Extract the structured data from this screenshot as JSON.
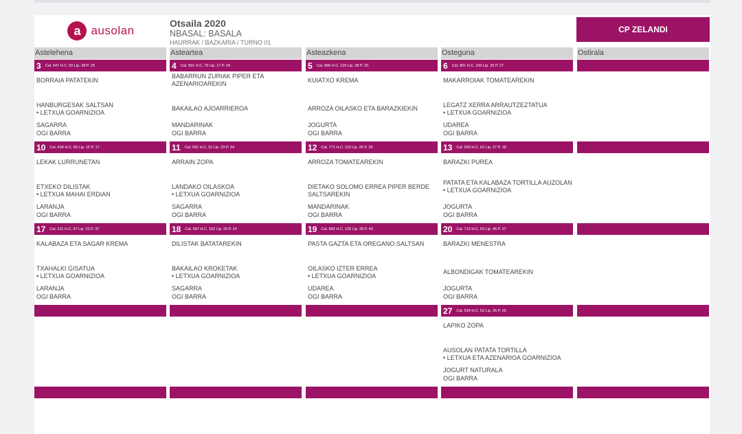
{
  "header": {
    "logo_letter": "a",
    "logo_text": "ausolan",
    "month": "Otsaila 2020",
    "menu_type": "NBASAL: BASALA",
    "subtitle": "HAURRAK / BAZKARIA / TURNO 01",
    "school": "CP ZELANDI"
  },
  "days": [
    "Astelehena",
    "Asteartea",
    "Asteazkena",
    "Osteguna",
    "Ostirala"
  ],
  "weeks": [
    [
      {
        "num": "3",
        "info": "Cal. 647 H.C. 50 Lip. 38 P. 25",
        "first": "BORRAIA PATATEKIN",
        "second": "HANBURGESAK SALTSAN",
        "second_note": "LETXUA GOARNIZIOA",
        "dessert": "SAGARRA",
        "bread": "OGI BARRA"
      },
      {
        "num": "4",
        "info": "Cal. 591 H.C. 79 Lip. 17 P. 34",
        "first": "BABARRUN ZURIAK PIPER ETA AZENARIOAREKIN",
        "second": "BAKAILAO AJOARRIEROA",
        "second_note": "",
        "dessert": "MANDARINAK",
        "bread": "OGI BARRA"
      },
      {
        "num": "5",
        "info": "Cal. 896 H.C. 125 Lip. 38 P. 20",
        "first": "KUIATXO KREMA",
        "second": "ARROZA OILASKO ETA BARAZKIEKIN",
        "second_note": "",
        "dessert": "JOGURTA",
        "bread": "OGI BARRA"
      },
      {
        "num": "6",
        "info": "Cal. 801 H.C. 100 Lip. 35 P. 27",
        "first": "MAKARROIAK TOMATEAREKIN",
        "second": "LEGATZ XERRA ARRAUTZEZTATUA",
        "second_note": "LETXUA GOARNIZIOA",
        "dessert": "UDAREA",
        "bread": "OGI BARRA"
      },
      null
    ],
    [
      {
        "num": "10",
        "info": "Cal. 434 H.C. 60 Lip. 15 P. 17",
        "first": "LEKAK LURRUNETAN",
        "second": "ETXEKO DILISTAK",
        "second_note": "LETXUA MAHAI ERDIAN",
        "dessert": "LARANJA",
        "bread": "OGI BARRA"
      },
      {
        "num": "11",
        "info": "Cal. 591 H.C. 51 Lip. 29 P. 34",
        "first": "ARRAIN ZOPA",
        "second": "LANDAKO OILASKOA",
        "second_note": "LETXUA GOARNIZIOA",
        "dessert": "SAGARRA",
        "bread": "OGI BARRA"
      },
      {
        "num": "12",
        "info": "Cal. 771 H.C. 110 Lip. 26 P. 29",
        "first": "ARROZA TOMATEAREKIN",
        "second": "DIETAKO SOLOMO ERREA PIPER BERDE SALTSAREKIN",
        "second_note": "",
        "dessert": "MANDARINAK",
        "bread": "OGI BARRA"
      },
      {
        "num": "13",
        "info": "Cal. 559 H.C. 62 Lip. 27 P. 18",
        "first": "BARAZKI PUREA",
        "second": "PATATA ETA KALABAZA TORTILLA AUZOLAN",
        "second_note": "LETXUA GOARNIZIOA",
        "dessert": "JOGURTA",
        "bread": "OGI BARRA"
      },
      null
    ],
    [
      {
        "num": "17",
        "info": "Cal. 611 H.C. 67 Lip. 23 P. 37",
        "first": "KALABAZA ETA SAGAR KREMA",
        "second": "TXAHALKI GISATUA",
        "second_note": "LETXUA GOARNIZIOA",
        "dessert": "LARANJA",
        "bread": "OGI BARRA"
      },
      {
        "num": "18",
        "info": "Cal. 687 H.C. 102 Lip. 23 P. 24",
        "first": "DILISTAK BATATAREKIN",
        "second": "BAKAILAO KROKETAK",
        "second_note": "LETXUA GOARNIZIOA",
        "dessert": "SAGARRA",
        "bread": "OGI BARRA"
      },
      {
        "num": "19",
        "info": "Cal. 882 H.C. 126 Lip. 28 P. 40",
        "first": "PASTA GAZTA ETA OREGANO SALTSAN",
        "second": "OILASKO IZTER ERREA",
        "second_note": "LETXUA GOARNIZIOA",
        "dessert": "UDAREA",
        "bread": "OGI BARRA"
      },
      {
        "num": "20",
        "info": "Cal. 713 H.C. 53 Lip. 45 P. 27",
        "first": "BARAZKI MENESTRA",
        "second": "ALBONDIGAK TOMATEAREKIN",
        "second_note": "",
        "dessert": "JOGURTA",
        "bread": "OGI BARRA"
      },
      null
    ],
    [
      null,
      null,
      null,
      {
        "num": "27",
        "info": "Cal. 534 H.C. 52 Lip. 26 P. 25",
        "first": "LAPIKO ZOPA",
        "second": "AUSOLAN PATATA TORTILLA",
        "second_note": "LETXUA ETA AZENARIOA GOARNIZIOA",
        "dessert": "JOGURT NATURALA",
        "bread": "OGI BARRA"
      },
      null
    ]
  ]
}
